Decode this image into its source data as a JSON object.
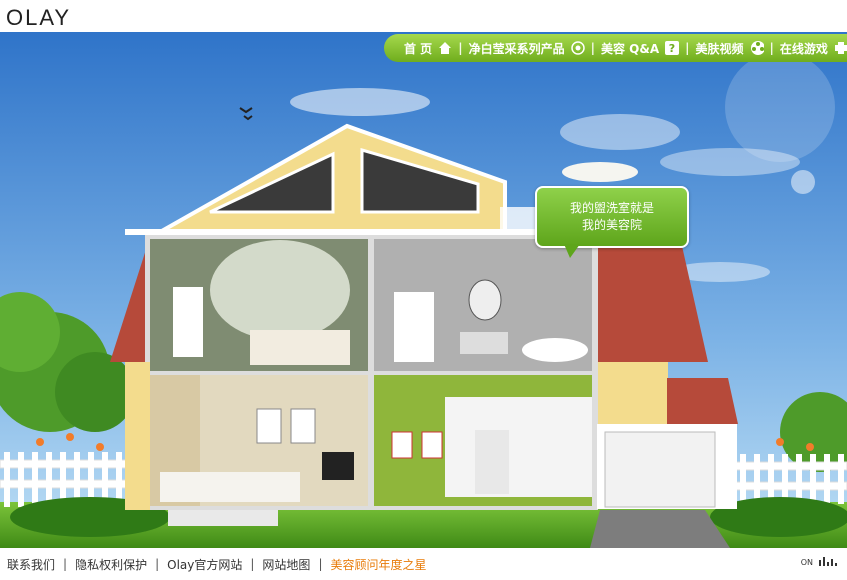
{
  "brand": {
    "logo_text": "OLAY"
  },
  "nav": {
    "items": [
      {
        "label": "首 页",
        "icon": "home-icon"
      },
      {
        "label": "净白莹采系列产品",
        "icon": "target-icon"
      },
      {
        "label": "美容 Q&A",
        "icon": "question-icon"
      },
      {
        "label": "美肤视频",
        "icon": "film-reel-icon"
      },
      {
        "label": "在线游戏",
        "icon": "puzzle-icon"
      }
    ]
  },
  "speech_bubble": {
    "line1": "我的盥洗室就是",
    "line2": "我的美容院"
  },
  "footer": {
    "links": [
      "联系我们",
      "隐私权利保护",
      "Olay官方网站",
      "网站地图"
    ],
    "highlight_link": "美容顾问年度之星",
    "highlight_color": "#e87c0a",
    "toggle_label": "ON"
  },
  "colors": {
    "nav_green": "#6fad1d",
    "sky": "#4a8fd6",
    "roof": "#b64a3a",
    "wall": "#f3dc8d"
  }
}
